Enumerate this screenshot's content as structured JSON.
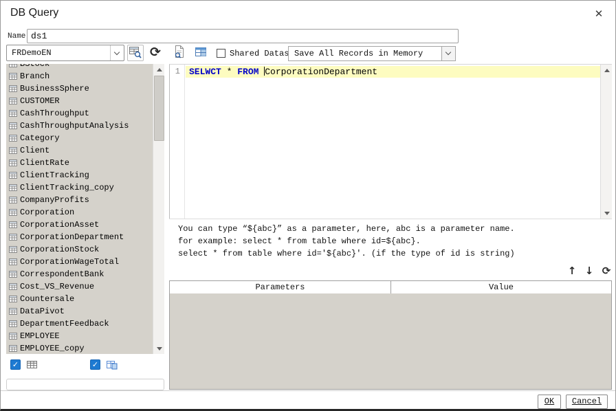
{
  "window": {
    "title": "DB Query"
  },
  "icons": {
    "close": "✕",
    "check": "✓",
    "refresh": "⟳",
    "up": "↑",
    "down": "↓"
  },
  "name_field": {
    "label": "Name:",
    "value": "ds1"
  },
  "left_panel": {
    "database_dropdown": {
      "value": "FRDemoEN"
    },
    "table_list": {
      "partial_item": "BStock",
      "items": [
        "Branch",
        "BusinessSphere",
        "CUSTOMER",
        "CashThroughput",
        "CashThroughputAnalysis",
        "Category",
        "Client",
        "ClientRate",
        "ClientTracking",
        "ClientTracking_copy",
        "CompanyProfits",
        "Corporation",
        "CorporationAsset",
        "CorporationDepartment",
        "CorporationStock",
        "CorporationWageTotal",
        "CorrespondentBank",
        "Cost_VS_Revenue",
        "Countersale",
        "DataPivot",
        "DepartmentFeedback",
        "EMPLOYEE",
        "EMPLOYEE_copy"
      ]
    }
  },
  "toolbar": {
    "shared_dataset_label": "Shared Dataset",
    "storage_dropdown": {
      "value": "Save All Records in Memory"
    }
  },
  "sql_editor": {
    "line_number": "1",
    "tokens": {
      "kw1": "SELWCT",
      "star": " * ",
      "kw2": "FROM",
      "space": " ",
      "table": "CorporationDepartment"
    }
  },
  "help": {
    "line1": "You can type “${abc}” as a parameter, here, abc is a parameter name.",
    "line2": "for example: select * from table where id=${abc}.",
    "line3": "select * from table where id='${abc}'. (if the type of id is string)"
  },
  "parameters_table": {
    "headers": [
      "Parameters",
      "Value"
    ],
    "rows": []
  },
  "footer": {
    "ok_label": "OK",
    "cancel_label": "Cancel"
  },
  "colors": {
    "accent_blue": "#1e7ad1",
    "keyword_blue": "#0000c8",
    "highlight_yellow": "#fdfcc0",
    "panel_gray": "#d5d2cb"
  }
}
